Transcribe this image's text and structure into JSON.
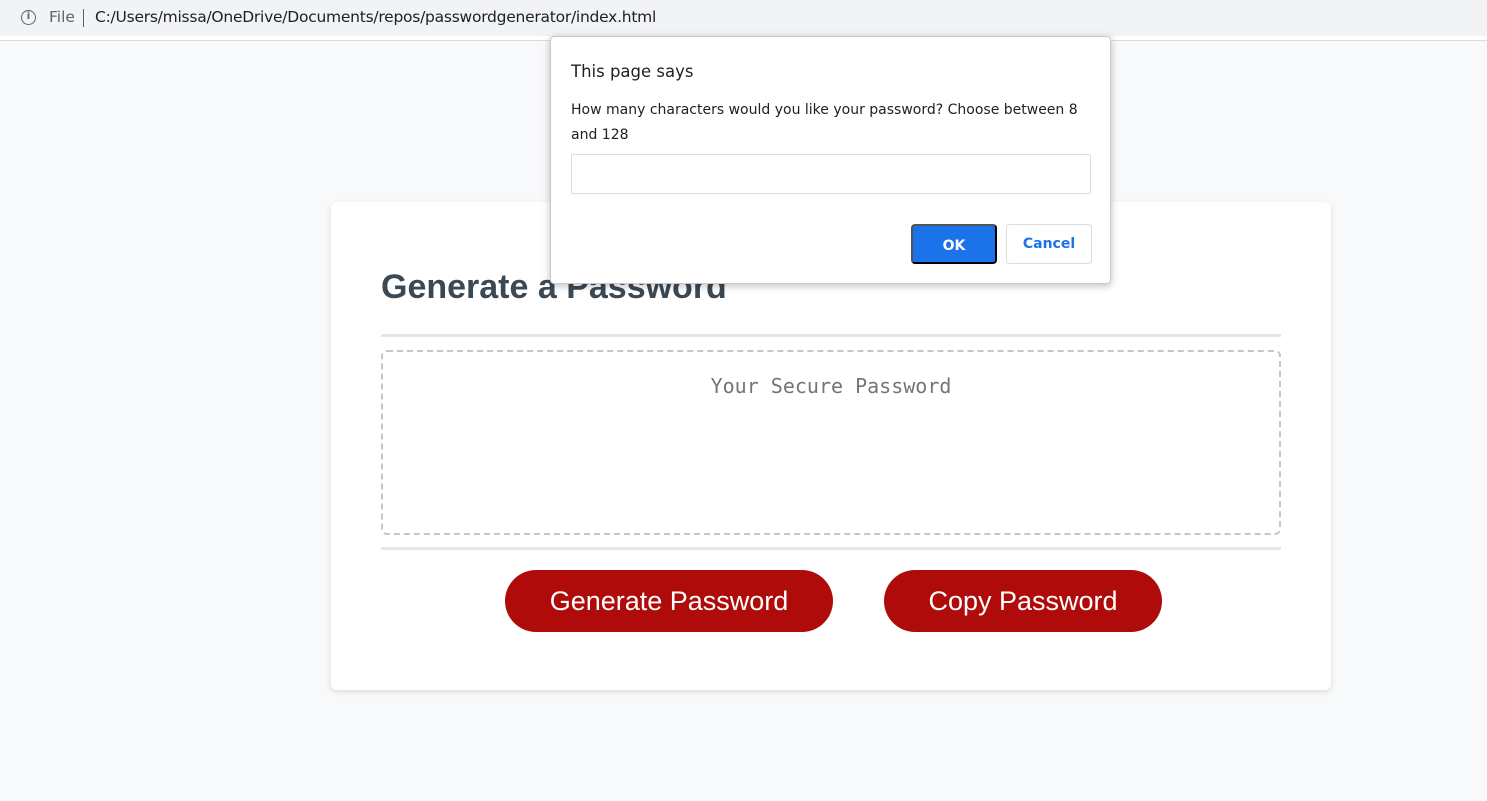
{
  "browser": {
    "scheme_label": "File",
    "url": "C:/Users/missa/OneDrive/Documents/repos/passwordgenerator/index.html"
  },
  "card": {
    "title": "Generate a Password",
    "password_placeholder": "Your Secure Password",
    "generate_label": "Generate Password",
    "copy_label": "Copy Password",
    "button_color": "#af0b0b"
  },
  "dialog": {
    "title": "This page says",
    "message": "How many characters would you like your password? Choose between 8 and 128",
    "input_value": "",
    "ok_label": "OK",
    "cancel_label": "Cancel",
    "accent_color": "#1a73e8"
  }
}
